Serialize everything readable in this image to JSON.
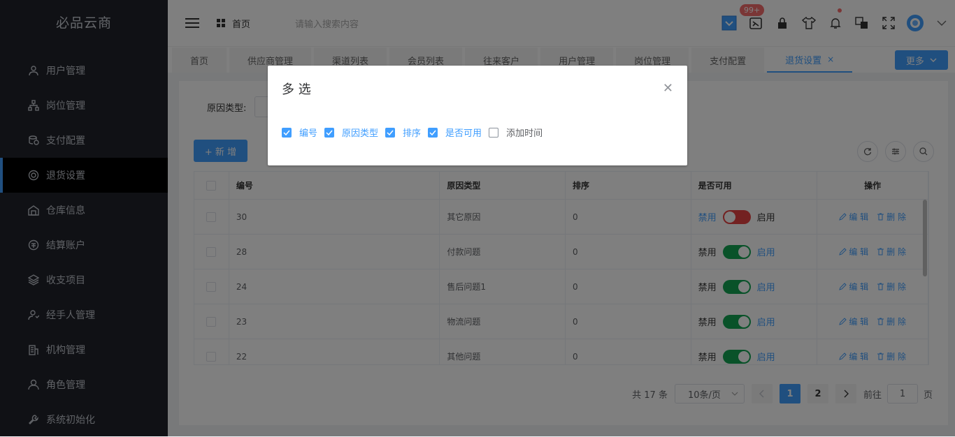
{
  "app": {
    "brand": "必品云商"
  },
  "sidebar": {
    "items": [
      {
        "label": "用户管理",
        "icon": "user-icon"
      },
      {
        "label": "岗位管理",
        "icon": "org-icon"
      },
      {
        "label": "支付配置",
        "icon": "coins-icon"
      },
      {
        "label": "退货设置",
        "icon": "return-icon",
        "active": true
      },
      {
        "label": "仓库信息",
        "icon": "warehouse-icon"
      },
      {
        "label": "结算账户",
        "icon": "account-icon"
      },
      {
        "label": "收支项目",
        "icon": "layers-icon"
      },
      {
        "label": "经手人管理",
        "icon": "handler-icon"
      },
      {
        "label": "机构管理",
        "icon": "building-icon"
      },
      {
        "label": "角色管理",
        "icon": "role-icon"
      },
      {
        "label": "系统初始化",
        "icon": "wrench-icon"
      }
    ]
  },
  "header": {
    "breadcrumb": "首页",
    "search_placeholder": "请输入搜索内容",
    "badge": "99+"
  },
  "tabs": [
    {
      "label": "首页"
    },
    {
      "label": "供应商管理"
    },
    {
      "label": "渠道列表"
    },
    {
      "label": "会员列表"
    },
    {
      "label": "往来客户"
    },
    {
      "label": "用户管理"
    },
    {
      "label": "岗位管理"
    },
    {
      "label": "支付配置"
    },
    {
      "label": "退货设置",
      "active": true
    }
  ],
  "more_label": "更多",
  "filter": {
    "label": "原因类型:"
  },
  "add_label": "+ 新 增",
  "table": {
    "headers": [
      "编号",
      "原因类型",
      "排序",
      "是否可用",
      "操作"
    ],
    "rows": [
      {
        "id": "30",
        "type": "其它原因",
        "sort": "0",
        "enabled": false
      },
      {
        "id": "28",
        "type": "付款问题",
        "sort": "0",
        "enabled": true
      },
      {
        "id": "24",
        "type": "售后问题1",
        "sort": "0",
        "enabled": true
      },
      {
        "id": "23",
        "type": "物流问题",
        "sort": "0",
        "enabled": true
      },
      {
        "id": "22",
        "type": "其他问题",
        "sort": "0",
        "enabled": true
      }
    ],
    "disable_label": "禁用",
    "enable_label": "启用",
    "edit_label": "编 辑",
    "delete_label": "删 除"
  },
  "pager": {
    "total": "共 17 条",
    "size": "10条/页",
    "pages": [
      "1",
      "2"
    ],
    "current": "1",
    "goto": "前往",
    "goto_value": "1",
    "page_unit": "页"
  },
  "dialog": {
    "title": "多 选",
    "options": [
      {
        "label": "编号",
        "checked": true
      },
      {
        "label": "原因类型",
        "checked": true
      },
      {
        "label": "排序",
        "checked": true
      },
      {
        "label": "是否可用",
        "checked": true
      },
      {
        "label": "添加时间",
        "checked": false
      }
    ]
  },
  "colors": {
    "primary": "#409eff",
    "sidebar": "#20232b",
    "switch_on": "#13a452",
    "switch_off": "#e64242"
  }
}
